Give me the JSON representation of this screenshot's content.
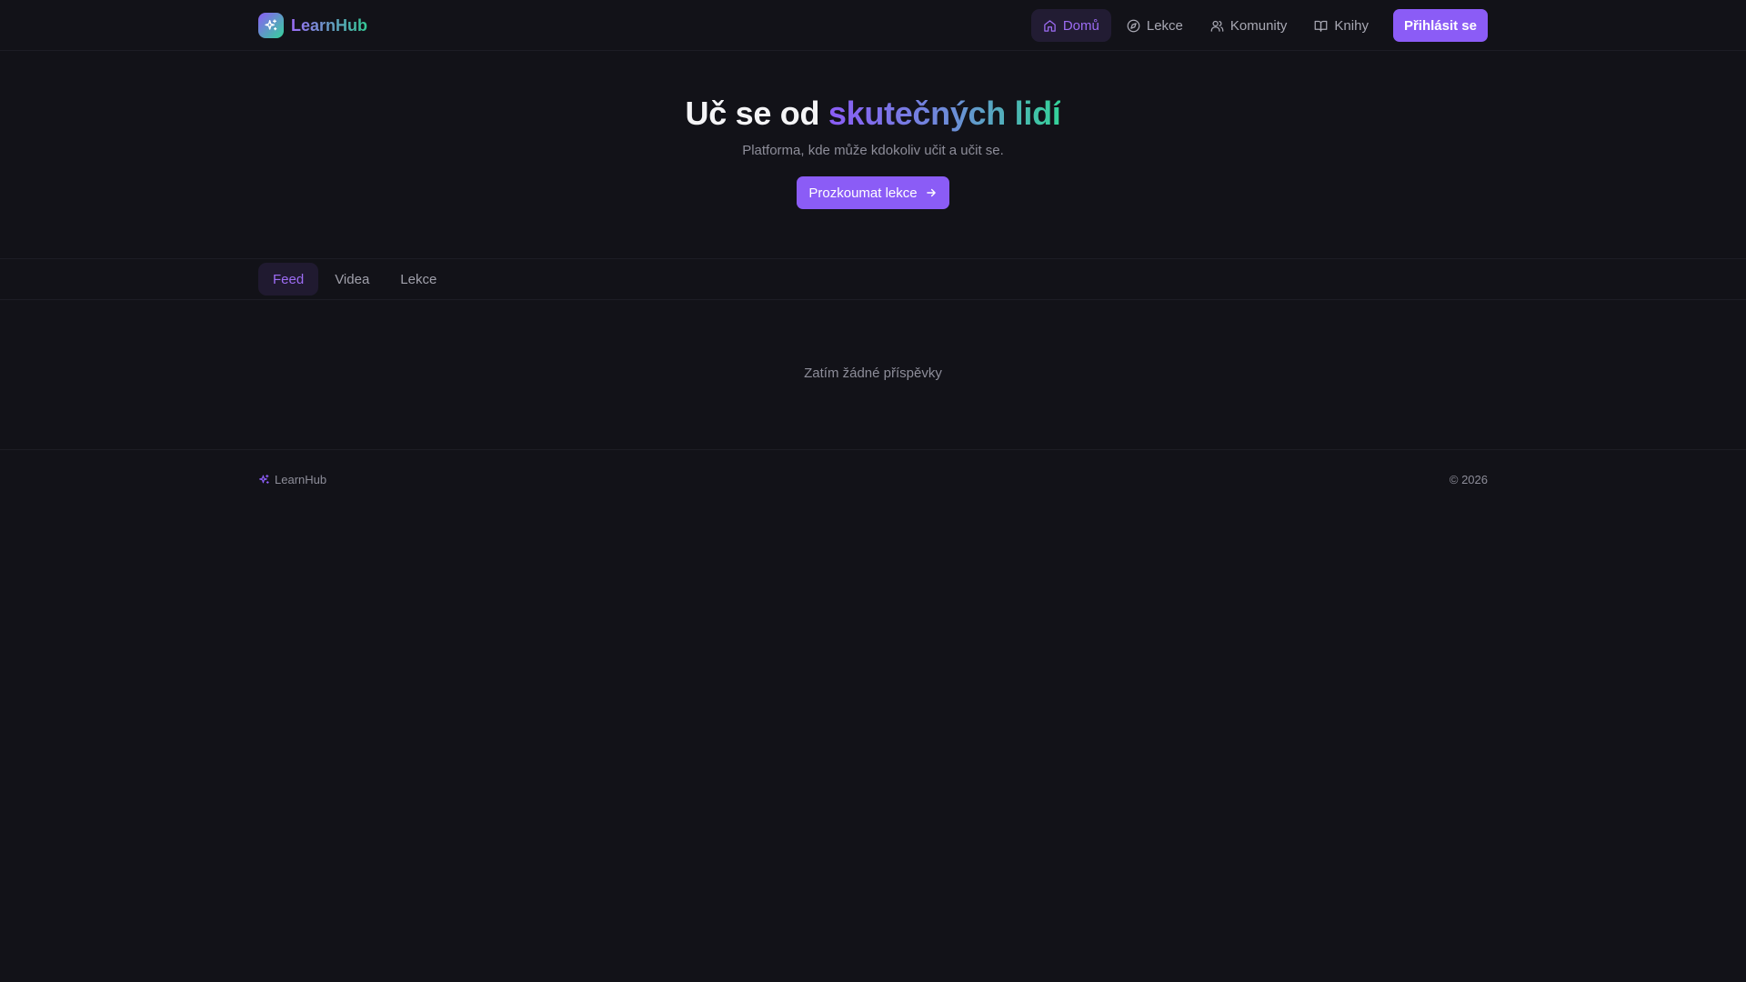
{
  "header": {
    "brand": "LearnHub",
    "nav": [
      {
        "label": "Domů",
        "icon": "home-icon",
        "active": true
      },
      {
        "label": "Lekce",
        "icon": "compass-icon",
        "active": false
      },
      {
        "label": "Komunity",
        "icon": "users-icon",
        "active": false
      },
      {
        "label": "Knihy",
        "icon": "book-icon",
        "active": false
      }
    ],
    "login_label": "Přihlásit se"
  },
  "hero": {
    "title_plain": "Uč se od ",
    "title_highlight": "skutečných lidí",
    "subtitle": "Platforma, kde může kdokoliv učit a učit se.",
    "cta_label": "Prozkoumat lekce"
  },
  "tabs": [
    {
      "label": "Feed",
      "active": true
    },
    {
      "label": "Videa",
      "active": false
    },
    {
      "label": "Lekce",
      "active": false
    }
  ],
  "feed": {
    "empty_text": "Zatím žádné příspěvky"
  },
  "footer": {
    "brand": "LearnHub",
    "copyright": "© 2026"
  },
  "colors": {
    "background": "#121218",
    "accent": "#8b5cf6",
    "accent_green": "#34d399",
    "muted_text": "#8d8d99"
  }
}
